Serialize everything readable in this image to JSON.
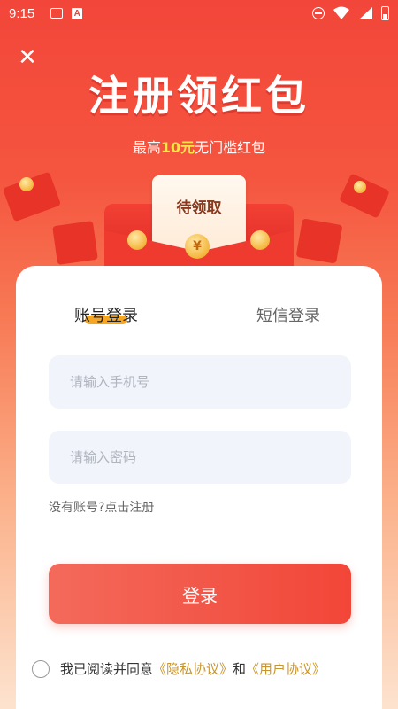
{
  "status_bar": {
    "time": "9:15",
    "left_icons": [
      "image-icon",
      "a-app-icon"
    ],
    "right_icons": [
      "dnd-icon",
      "wifi-icon",
      "signal-icon",
      "battery-icon"
    ]
  },
  "header": {
    "close_icon": "close-icon",
    "close_glyph": "✕",
    "title": "注册领红包",
    "subtitle_prefix": "最高",
    "subtitle_highlight": "10元",
    "subtitle_suffix": "无门槛红包"
  },
  "envelope": {
    "card_label": "待领取",
    "coin_symbol": "¥"
  },
  "login": {
    "tabs": [
      {
        "label": "账号登录",
        "active": true
      },
      {
        "label": "短信登录",
        "active": false
      }
    ],
    "phone_placeholder": "请输入手机号",
    "password_placeholder": "请输入密码",
    "register_link": "没有账号?点击注册",
    "login_button": "登录",
    "agreement": {
      "prefix": "我已阅读并同意",
      "privacy": "《隐私协议》",
      "and": "和",
      "user": "《用户协议》"
    }
  },
  "colors": {
    "brand_red": "#f24638",
    "highlight_yellow": "#ffe14a",
    "tab_underline": "#f5a623",
    "link_gold": "#c9962d",
    "input_bg": "#f1f4fb"
  }
}
